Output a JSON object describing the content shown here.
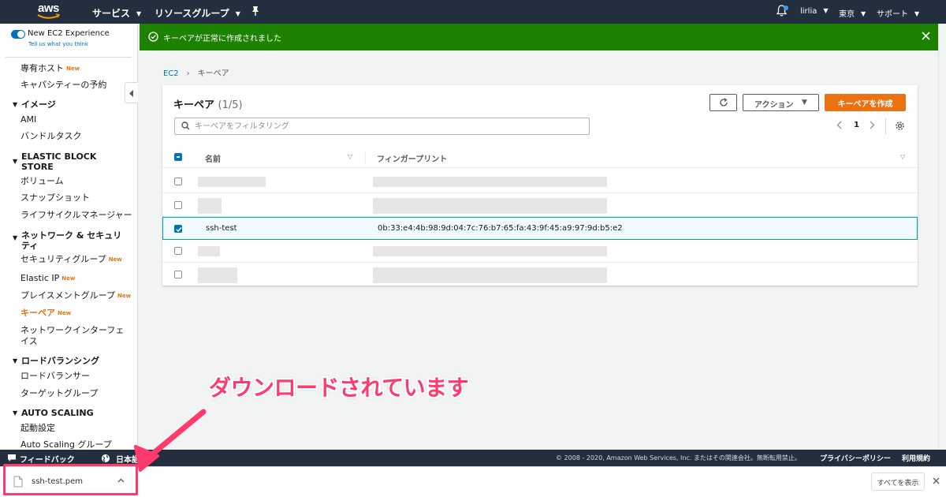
{
  "topnav": {
    "logo_text": "aws",
    "services": "サービス",
    "resource_groups": "リソースグループ",
    "user": "lirlia",
    "region": "東京",
    "support": "サポート"
  },
  "sidebar": {
    "new_experience": "New EC2 Experience",
    "tell_us": "Tell us what you think",
    "new_badge": "New",
    "items": {
      "dedicated_hosts": "専有ホスト",
      "capacity_reservations": "キャパシティーの予約",
      "images_header": "イメージ",
      "ami": "AMI",
      "bundle_tasks": "バンドルタスク",
      "ebs_header": "ELASTIC BLOCK STORE",
      "volumes": "ボリューム",
      "snapshots": "スナップショット",
      "lifecycle_manager": "ライフサイクルマネージャー",
      "network_header": "ネットワーク & セキュリティ",
      "security_groups": "セキュリティグループ",
      "elastic_ip": "Elastic IP",
      "placement_groups": "プレイスメントグループ",
      "key_pairs": "キーペア",
      "network_interfaces": "ネットワークインターフェイス",
      "lb_header": "ロードバランシング",
      "load_balancers": "ロードバランサー",
      "target_groups": "ターゲットグループ",
      "as_header": "AUTO SCALING",
      "launch_configs": "起動設定",
      "as_groups": "Auto Scaling グループ"
    }
  },
  "flash": {
    "message": "キーペアが正常に作成されました",
    "color": "#1d8102"
  },
  "breadcrumb": {
    "root": "EC2",
    "current": "キーペア"
  },
  "panel": {
    "title": "キーペア",
    "count": "(1/5)",
    "action_label": "アクション",
    "create_label": "キーペアを作成",
    "search_placeholder": "キーペアをフィルタリング",
    "page": "1",
    "columns": {
      "name": "名前",
      "fingerprint": "フィンガープリント"
    },
    "selected_row": {
      "name": "ssh-test",
      "fingerprint": "0b:33:e4:4b:98:9d:04:7c:76:b7:65:fa:43:9f:45:a9:97:9d:b5:e2"
    }
  },
  "footer": {
    "feedback": "フィードバック",
    "language": "日本語",
    "copyright": "© 2008 - 2020, Amazon Web Services, Inc. またはその関連会社。無断転用禁止。",
    "privacy": "プライバシーポリシー",
    "terms": "利用規約"
  },
  "download_bar": {
    "filename": "ssh-test.pem",
    "show_all": "すべてを表示"
  },
  "annotation": {
    "text": "ダウンロードされています",
    "color": "#ff3b6e"
  },
  "colors": {
    "nav": "#232f3e",
    "accent": "#ec7211",
    "link": "#0073bb"
  }
}
